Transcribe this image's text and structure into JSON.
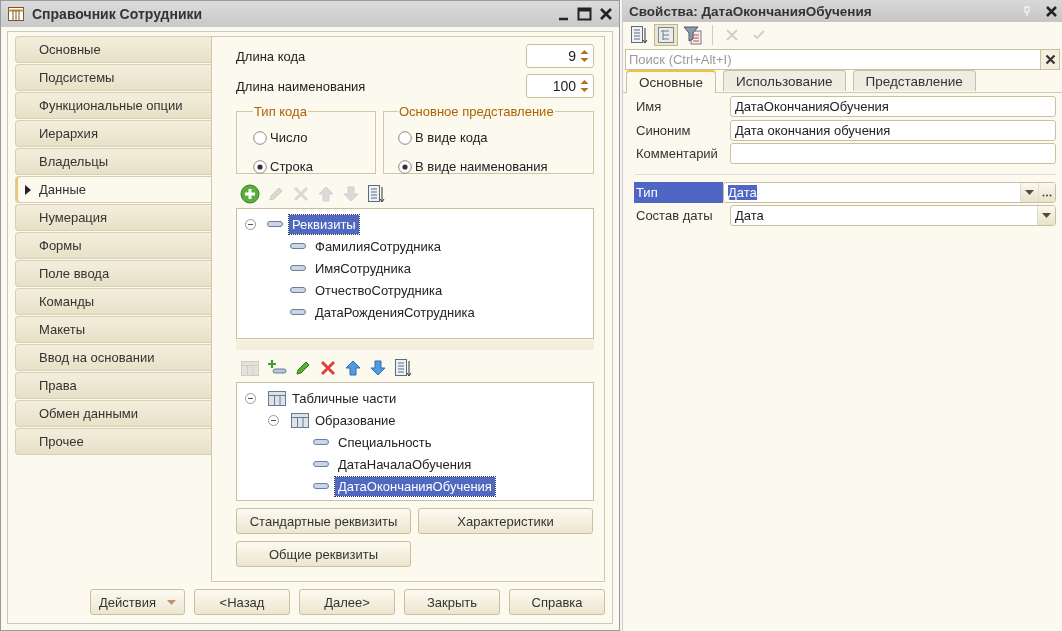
{
  "window": {
    "title": "Справочник Сотрудники"
  },
  "sections": [
    {
      "label": "Основные",
      "selected": false
    },
    {
      "label": "Подсистемы",
      "selected": false
    },
    {
      "label": "Функциональные опции",
      "selected": false
    },
    {
      "label": "Иерархия",
      "selected": false
    },
    {
      "label": "Владельцы",
      "selected": false
    },
    {
      "label": "Данные",
      "selected": true
    },
    {
      "label": "Нумерация",
      "selected": false
    },
    {
      "label": "Формы",
      "selected": false
    },
    {
      "label": "Поле ввода",
      "selected": false
    },
    {
      "label": "Команды",
      "selected": false
    },
    {
      "label": "Макеты",
      "selected": false
    },
    {
      "label": "Ввод на основании",
      "selected": false
    },
    {
      "label": "Права",
      "selected": false
    },
    {
      "label": "Обмен данными",
      "selected": false
    },
    {
      "label": "Прочее",
      "selected": false
    }
  ],
  "fields": [
    {
      "label": "Длина кода",
      "value": "9"
    },
    {
      "label": "Длина наименования",
      "value": "100"
    }
  ],
  "groups": [
    {
      "title": "Тип кода",
      "options": [
        {
          "label": "Число",
          "selected": false
        },
        {
          "label": "Строка",
          "selected": true
        }
      ]
    },
    {
      "title": "Основное представление",
      "options": [
        {
          "label": "В виде кода",
          "selected": false
        },
        {
          "label": "В виде наименования",
          "selected": true
        }
      ]
    }
  ],
  "attributes_toolbar": [
    {
      "kind": "add",
      "disabled": false
    },
    {
      "kind": "edit",
      "disabled": true
    },
    {
      "kind": "delete",
      "disabled": true
    },
    {
      "kind": "up",
      "disabled": true
    },
    {
      "kind": "down",
      "disabled": true
    },
    {
      "kind": "sort",
      "disabled": false
    }
  ],
  "attributes_tree": [
    {
      "label": "Реквизиты",
      "kind": "attribute",
      "expanded": true,
      "selected": true,
      "children": [
        {
          "label": "ФамилияСотрудника",
          "kind": "attribute",
          "selected": false
        },
        {
          "label": "ИмяСотрудника",
          "kind": "attribute",
          "selected": false
        },
        {
          "label": "ОтчествоСотрудника",
          "kind": "attribute",
          "selected": false
        },
        {
          "label": "ДатаРожденияСотрудника",
          "kind": "attribute",
          "selected": false
        }
      ]
    }
  ],
  "tables_toolbar": [
    {
      "kind": "table",
      "disabled": true
    },
    {
      "kind": "add-row",
      "disabled": false
    },
    {
      "kind": "edit",
      "disabled": false
    },
    {
      "kind": "delete",
      "disabled": false
    },
    {
      "kind": "up",
      "disabled": false
    },
    {
      "kind": "down",
      "disabled": false
    },
    {
      "kind": "sort",
      "disabled": false
    }
  ],
  "tables_tree": [
    {
      "label": "Табличные части",
      "kind": "table",
      "expanded": true,
      "selected": false,
      "children": [
        {
          "label": "Образование",
          "kind": "table",
          "expanded": true,
          "selected": false,
          "children": [
            {
              "label": "Специальность",
              "kind": "attribute",
              "selected": false
            },
            {
              "label": "ДатаНачалаОбучения",
              "kind": "attribute",
              "selected": false
            },
            {
              "label": "ДатаОкончанияОбучения",
              "kind": "attribute",
              "selected": true
            }
          ]
        }
      ]
    }
  ],
  "panel_buttons": [
    "Стандартные реквизиты",
    "Характеристики",
    "Общие реквизиты"
  ],
  "footer_buttons": [
    {
      "label": "Действия",
      "kind": "menu"
    },
    {
      "label": "<Назад",
      "kind": "plain"
    },
    {
      "label": "Далее>",
      "kind": "plain"
    },
    {
      "label": "Закрыть",
      "kind": "plain"
    },
    {
      "label": "Справка",
      "kind": "plain"
    }
  ],
  "properties": {
    "title": "Свойства: ДатаОкончанияОбучения",
    "toolbar": [
      {
        "kind": "sort",
        "selected": false,
        "disabled": false
      },
      {
        "kind": "tree",
        "selected": true,
        "disabled": false
      },
      {
        "kind": "filter",
        "selected": false,
        "disabled": false
      },
      {
        "kind": "cancel",
        "selected": false,
        "disabled": true
      },
      {
        "kind": "apply",
        "selected": false,
        "disabled": true
      }
    ],
    "search": {
      "placeholder": "Поиск (Ctrl+Alt+I)"
    },
    "tabs": [
      {
        "label": "Основные",
        "selected": true
      },
      {
        "label": "Использование",
        "selected": false
      },
      {
        "label": "Представление",
        "selected": false
      }
    ],
    "fields": [
      {
        "label": "Имя",
        "value": "ДатаОкончанияОбучения"
      },
      {
        "label": "Синоним",
        "value": "Дата окончания обучения"
      },
      {
        "label": "Комментарий"
      }
    ],
    "type_fields": [
      {
        "label": "Тип",
        "value": "Дата",
        "kind": "type-choice",
        "selected": true
      },
      {
        "label": "Состав даты",
        "value": "Дата",
        "kind": "select",
        "selected": false
      }
    ]
  }
}
